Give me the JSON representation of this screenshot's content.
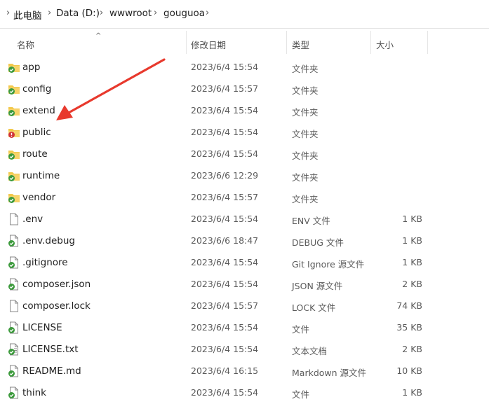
{
  "breadcrumb": {
    "items": [
      "此电脑",
      "Data (D:)",
      "wwwroot",
      "gouguoa"
    ]
  },
  "columns": {
    "name": "名称",
    "modified": "修改日期",
    "type": "类型",
    "size": "大小"
  },
  "files": [
    {
      "name": "app",
      "modified": "2023/6/4 15:54",
      "type": "文件夹",
      "size": "",
      "icon": "folder-synced-icon"
    },
    {
      "name": "config",
      "modified": "2023/6/4 15:57",
      "type": "文件夹",
      "size": "",
      "icon": "folder-synced-icon"
    },
    {
      "name": "extend",
      "modified": "2023/6/4 15:54",
      "type": "文件夹",
      "size": "",
      "icon": "folder-synced-icon"
    },
    {
      "name": "public",
      "modified": "2023/6/4 15:54",
      "type": "文件夹",
      "size": "",
      "icon": "folder-error-icon"
    },
    {
      "name": "route",
      "modified": "2023/6/4 15:54",
      "type": "文件夹",
      "size": "",
      "icon": "folder-synced-icon"
    },
    {
      "name": "runtime",
      "modified": "2023/6/6 12:29",
      "type": "文件夹",
      "size": "",
      "icon": "folder-synced-icon"
    },
    {
      "name": "vendor",
      "modified": "2023/6/4 15:57",
      "type": "文件夹",
      "size": "",
      "icon": "folder-synced-icon"
    },
    {
      "name": ".env",
      "modified": "2023/6/4 15:54",
      "type": "ENV 文件",
      "size": "1 KB",
      "icon": "file-blank-icon"
    },
    {
      "name": ".env.debug",
      "modified": "2023/6/6 18:47",
      "type": "DEBUG 文件",
      "size": "1 KB",
      "icon": "file-synced-icon"
    },
    {
      "name": ".gitignore",
      "modified": "2023/6/4 15:54",
      "type": "Git Ignore 源文件",
      "size": "1 KB",
      "icon": "file-synced-icon"
    },
    {
      "name": "composer.json",
      "modified": "2023/6/4 15:54",
      "type": "JSON 源文件",
      "size": "2 KB",
      "icon": "file-synced-icon"
    },
    {
      "name": "composer.lock",
      "modified": "2023/6/4 15:57",
      "type": "LOCK 文件",
      "size": "74 KB",
      "icon": "file-blank-icon"
    },
    {
      "name": "LICENSE",
      "modified": "2023/6/4 15:54",
      "type": "文件",
      "size": "35 KB",
      "icon": "file-synced-icon"
    },
    {
      "name": "LICENSE.txt",
      "modified": "2023/6/4 15:54",
      "type": "文本文档",
      "size": "2 KB",
      "icon": "file-text-synced-icon"
    },
    {
      "name": "README.md",
      "modified": "2023/6/4 16:15",
      "type": "Markdown 源文件",
      "size": "10 KB",
      "icon": "file-synced-icon"
    },
    {
      "name": "think",
      "modified": "2023/6/4 15:54",
      "type": "文件",
      "size": "1 KB",
      "icon": "file-synced-icon"
    }
  ],
  "colors": {
    "folder": "#f2c94c",
    "sync_green": "#3c9a3c",
    "error_red": "#d13438",
    "arrow": "#e8392d"
  }
}
